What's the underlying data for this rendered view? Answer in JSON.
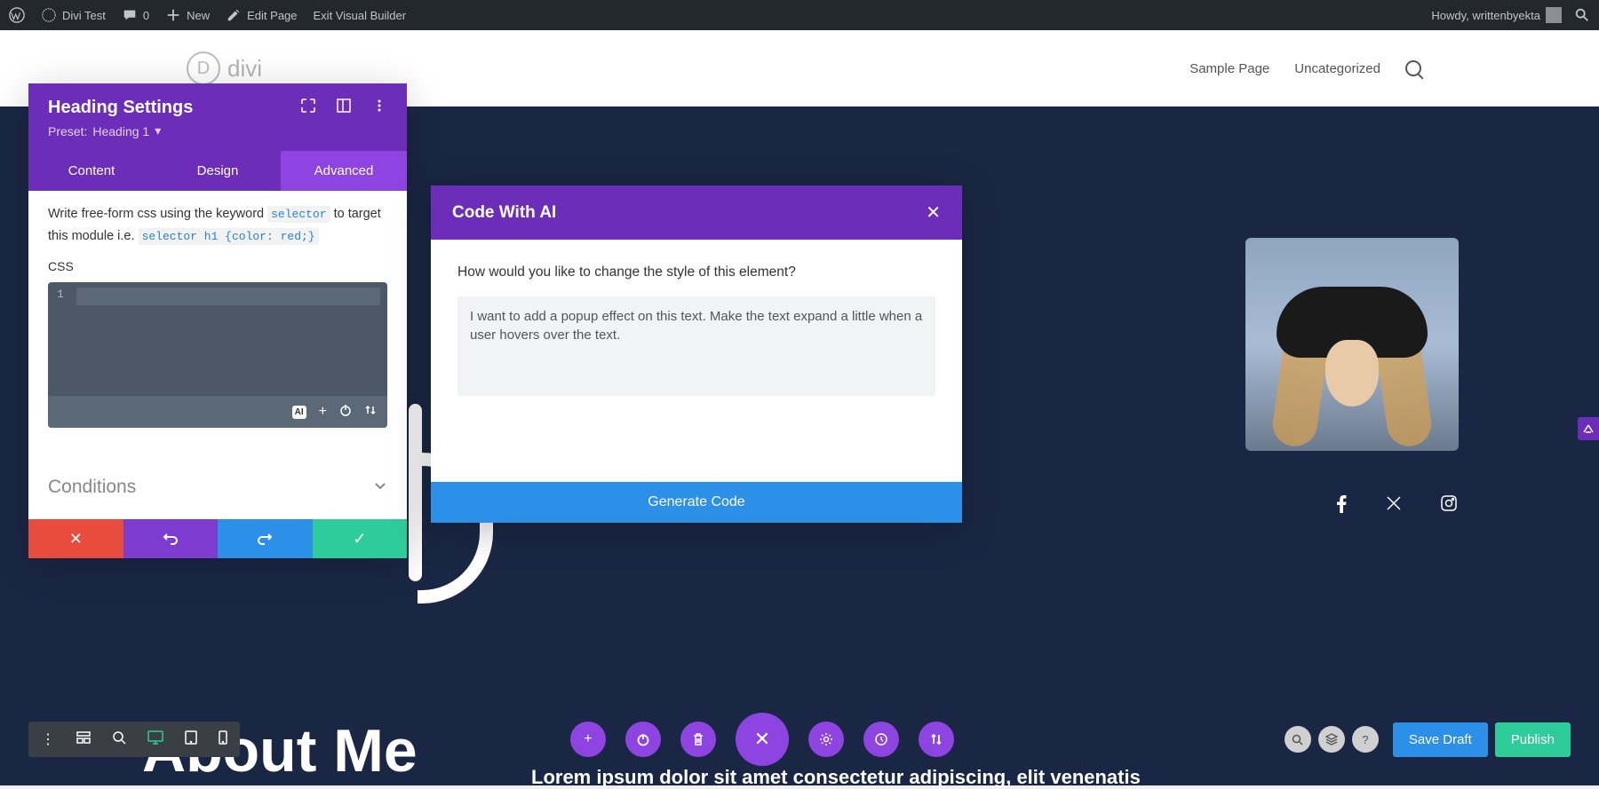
{
  "admin": {
    "site": "Divi Test",
    "comments": "0",
    "new": "New",
    "edit": "Edit Page",
    "exit": "Exit Visual Builder",
    "howdy": "Howdy, writtenbyekta"
  },
  "header": {
    "logo": "divi",
    "nav": [
      "Sample Page",
      "Uncategorized"
    ]
  },
  "panel": {
    "title": "Heading Settings",
    "preset_label": "Preset:",
    "preset_value": "Heading 1",
    "tabs": [
      "Content",
      "Design",
      "Advanced"
    ],
    "active_tab": 2,
    "help_1": "Write free-form css using the keyword ",
    "help_kw1": "selector",
    "help_2": " to target this module i.e. ",
    "help_kw2": "selector h1 {color: red;}",
    "css_label": "CSS",
    "line_num": "1",
    "ai_badge": "AI",
    "conditions": "Conditions"
  },
  "ai": {
    "title": "Code With AI",
    "prompt": "How would you like to change the style of this element?",
    "text": "I want to add a popup effect on this text. Make the text expand a little when a user hovers over the text.",
    "generate": "Generate Code"
  },
  "hero": {
    "title": "About Me",
    "para": "Lorem ipsum dolor sit amet consectetur adipiscing, elit venenatis"
  },
  "bottom": {
    "save_draft": "Save Draft",
    "publish": "Publish"
  }
}
